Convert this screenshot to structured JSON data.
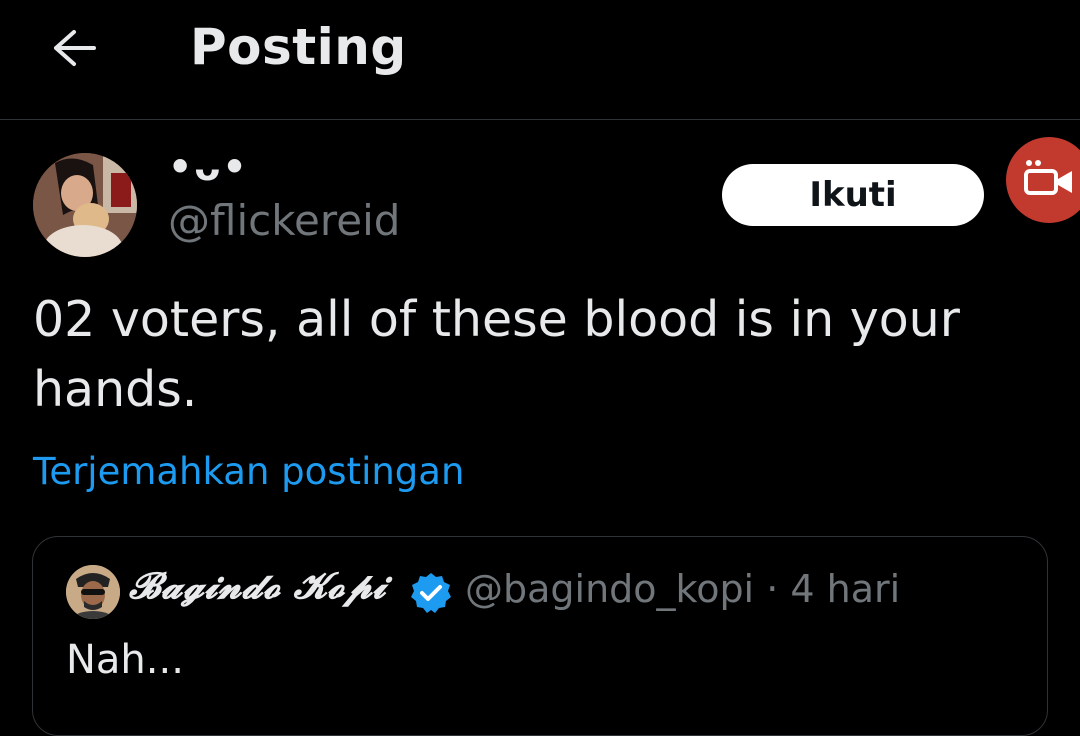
{
  "header": {
    "back_icon": "arrow-left-icon",
    "title": "Posting"
  },
  "post": {
    "author": {
      "display_name": "•ᴗ•",
      "handle": "@flickereid"
    },
    "follow_label": "Ikuti",
    "text": "02 voters, all of these blood is in your hands.",
    "translate_label": "Terjemahkan postingan"
  },
  "quote": {
    "display_name": "𝓑𝓪𝓰𝓲𝓷𝓭𝓸 𝓚𝓸𝓹𝓲",
    "verified_icon": "verified-badge-icon",
    "handle": "@bagindo_kopi",
    "separator": "·",
    "time": "4 hari",
    "text": "Nah..."
  },
  "fab": {
    "icon": "video-camera-icon"
  },
  "colors": {
    "background": "#000000",
    "text_primary": "#e7e9ea",
    "text_secondary": "#71767b",
    "link": "#1d9bf0",
    "divider": "#2f3336",
    "follow_bg": "#ffffff",
    "fab_bg": "#c23a2e"
  }
}
